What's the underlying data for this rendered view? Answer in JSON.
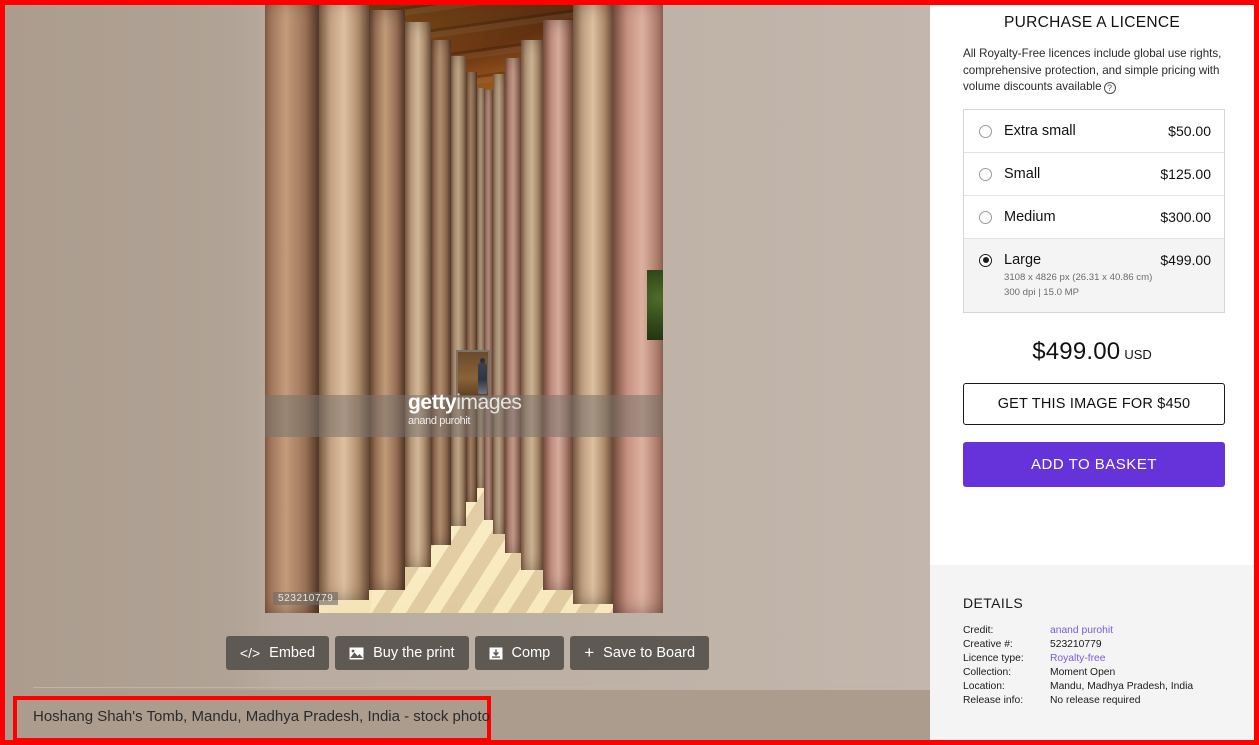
{
  "photo": {
    "alt_description": "Hoshang Shah's Tomb colonnade with carved sandstone pillars",
    "watermark_brand_bold": "getty",
    "watermark_brand_light": "images",
    "watermark_author": "anand purohit",
    "id_watermark": "523210779"
  },
  "toolbar": {
    "buttons": [
      {
        "icon": "code-embed-icon",
        "glyph": "</>",
        "label": "Embed"
      },
      {
        "icon": "print-image-icon",
        "glyph": "ὛC",
        "label": "Buy the print"
      },
      {
        "icon": "download-comp-icon",
        "glyph": "⬇",
        "label": "Comp"
      },
      {
        "icon": "plus-icon",
        "glyph": "+",
        "label": "Save to Board"
      }
    ]
  },
  "caption": {
    "text": "Hoshang Shah's Tomb, Mandu, Madhya Pradesh, India - stock photo"
  },
  "purchase": {
    "title": "PURCHASE A LICENCE",
    "blurb": "All Royalty-Free licences include global use rights, comprehensive protection, and simple pricing with volume discounts available",
    "help_icon": "help-circle-icon",
    "help_glyph": "?",
    "sizes": [
      {
        "label": "Extra small",
        "price": "$50.00",
        "meta1": "",
        "meta2": "",
        "selected": false
      },
      {
        "label": "Small",
        "price": "$125.00",
        "meta1": "",
        "meta2": "",
        "selected": false
      },
      {
        "label": "Medium",
        "price": "$300.00",
        "meta1": "",
        "meta2": "",
        "selected": false
      },
      {
        "label": "Large",
        "price": "$499.00",
        "meta1": "3108 x 4826 px (26.31 x 40.86 cm)",
        "meta2": "300 dpi | 15.0 MP",
        "selected": true
      }
    ],
    "total_amount": "$499.00",
    "currency": "USD",
    "get_image_label": "GET THIS IMAGE FOR $450",
    "add_basket_label": "ADD TO BASKET",
    "accent_color": "#6633db"
  },
  "details": {
    "title": "DETAILS",
    "rows": [
      {
        "key": "Credit:",
        "value": "anand purohit",
        "link": true
      },
      {
        "key": "Creative #:",
        "value": "523210779",
        "link": false
      },
      {
        "key": "Licence type:",
        "value": "Royalty-free",
        "link": true
      },
      {
        "key": "Collection:",
        "value": "Moment Open",
        "link": false
      },
      {
        "key": "Location:",
        "value": "Mandu, Madhya Pradesh, India",
        "link": false
      },
      {
        "key": "Release info:",
        "value": "No release required",
        "link": false
      }
    ]
  }
}
